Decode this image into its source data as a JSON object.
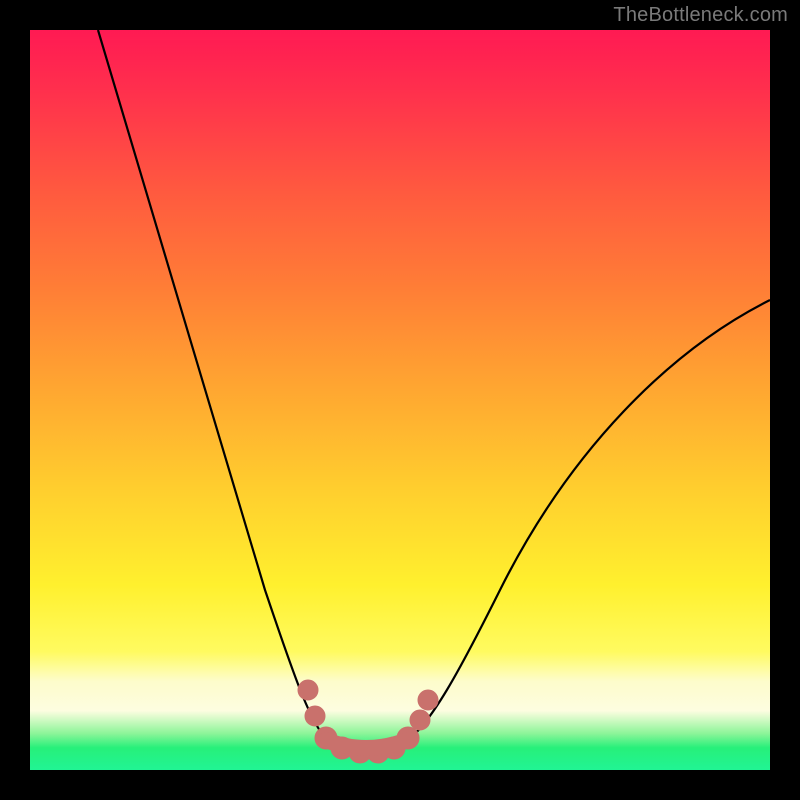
{
  "watermark": {
    "text": "TheBottleneck.com"
  },
  "chart_data": {
    "type": "line",
    "title": "",
    "xlabel": "",
    "ylabel": "",
    "xlim": [
      0,
      100
    ],
    "ylim": [
      0,
      100
    ],
    "series": [
      {
        "name": "bottleneck-curve",
        "x": [
          10,
          14,
          18,
          22,
          26,
          30,
          33,
          36,
          38,
          40,
          42,
          44,
          46,
          48,
          50,
          54,
          58,
          62,
          66,
          70,
          75,
          80,
          85,
          90,
          95,
          100
        ],
        "y": [
          100,
          88,
          76,
          64,
          52,
          40,
          30,
          22,
          15,
          10,
          6,
          3,
          2,
          2,
          2,
          3,
          6,
          10,
          16,
          22,
          30,
          38,
          45,
          52,
          58,
          63
        ]
      }
    ],
    "markers": {
      "name": "valley-markers",
      "color": "#c76a66",
      "points": [
        {
          "x": 38,
          "y": 10
        },
        {
          "x": 39,
          "y": 6
        },
        {
          "x": 40,
          "y": 3
        },
        {
          "x": 42,
          "y": 2
        },
        {
          "x": 44,
          "y": 2
        },
        {
          "x": 46,
          "y": 2
        },
        {
          "x": 48,
          "y": 2
        },
        {
          "x": 50,
          "y": 3
        },
        {
          "x": 52,
          "y": 6
        },
        {
          "x": 53,
          "y": 9
        }
      ]
    },
    "gradient_stops": [
      {
        "pos": 0,
        "color": "#ff1a53"
      },
      {
        "pos": 50,
        "color": "#ffa531"
      },
      {
        "pos": 80,
        "color": "#fff02e"
      },
      {
        "pos": 90,
        "color": "#fdfde0"
      },
      {
        "pos": 100,
        "color": "#21f494"
      }
    ]
  }
}
